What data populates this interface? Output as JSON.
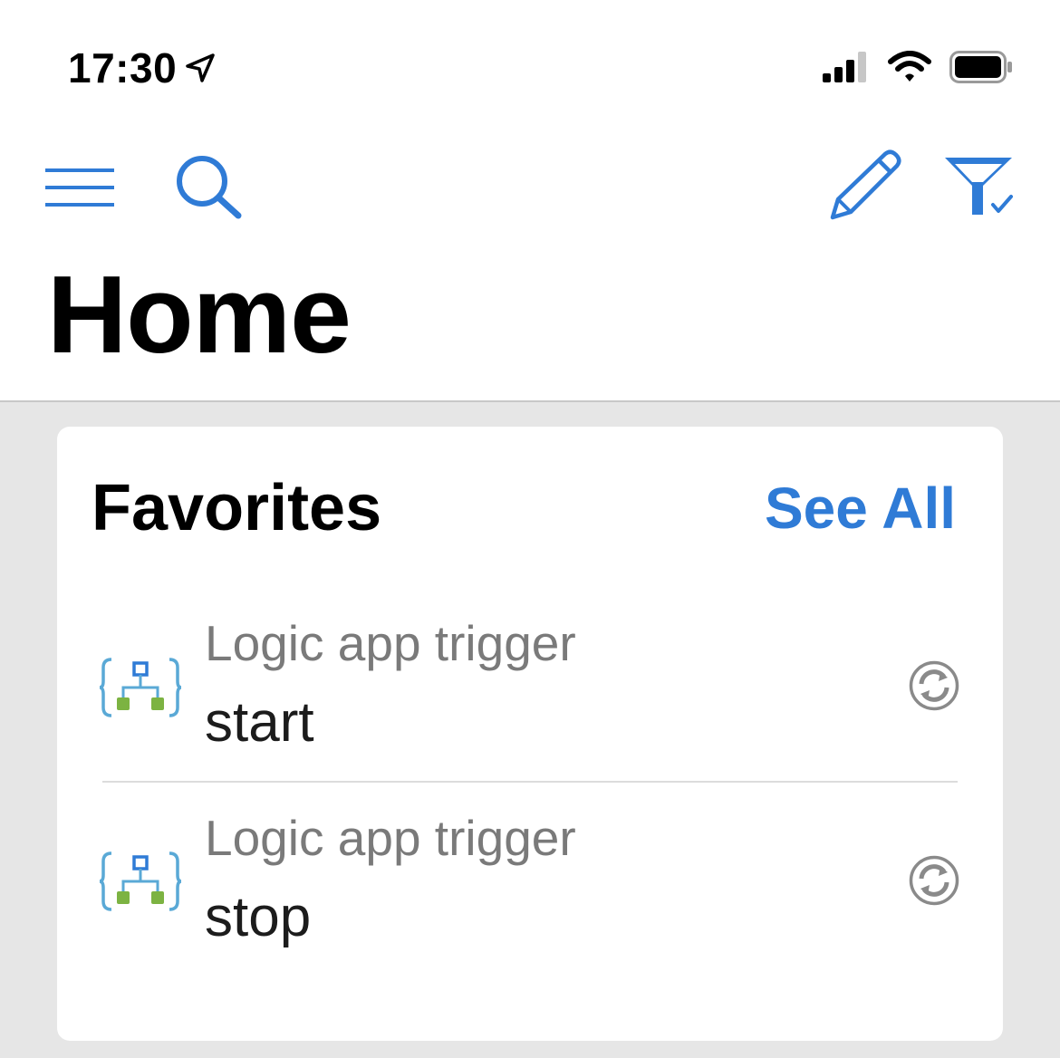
{
  "status_bar": {
    "time": "17:30",
    "location_icon": "location-arrow-icon",
    "signal_icon": "cellular-signal-icon",
    "wifi_icon": "wifi-icon",
    "battery_icon": "battery-icon"
  },
  "nav": {
    "menu_icon": "hamburger-menu-icon",
    "search_icon": "search-icon",
    "edit_icon": "pencil-icon",
    "filter_icon": "filter-check-icon"
  },
  "page": {
    "title": "Home"
  },
  "favorites": {
    "title": "Favorites",
    "see_all_label": "See All",
    "items": [
      {
        "type": "Logic app trigger",
        "name": "start",
        "icon": "logic-app-icon",
        "action_icon": "refresh-icon"
      },
      {
        "type": "Logic app trigger",
        "name": "stop",
        "icon": "logic-app-icon",
        "action_icon": "refresh-icon"
      }
    ]
  },
  "colors": {
    "accent": "#2f7bd6",
    "background": "#e6e6e6",
    "logic_blue": "#2f7bd6",
    "logic_green": "#7cb342",
    "logic_brace": "#5aa9d6"
  }
}
